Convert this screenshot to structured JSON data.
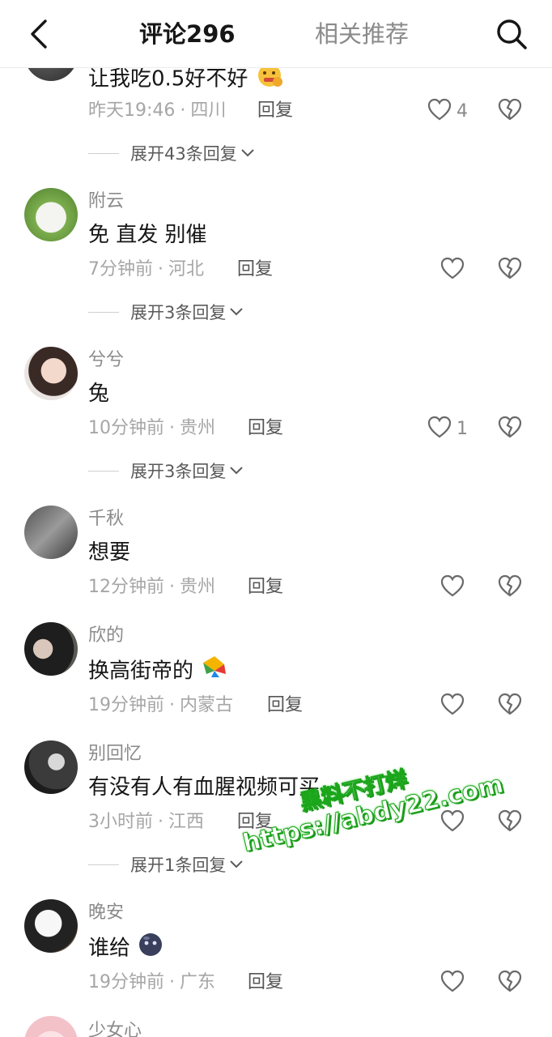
{
  "header": {
    "tab_comments_label": "评论",
    "tab_comments_count": "296",
    "tab_related_label": "相关推荐"
  },
  "comments": [
    {
      "username": "",
      "content": "让我吃0.5好不好",
      "emoji": "money-mouth-emoji",
      "time": "昨天19:46",
      "location": "四川",
      "reply": "回复",
      "likes": "4",
      "expand": "展开43条回复"
    },
    {
      "username": "附云",
      "content": "免 直发 别催",
      "time": "7分钟前",
      "location": "河北",
      "reply": "回复",
      "likes": "",
      "expand": "展开3条回复"
    },
    {
      "username": "兮兮",
      "content": "兔",
      "time": "10分钟前",
      "location": "贵州",
      "reply": "回复",
      "likes": "1",
      "expand": "展开3条回复"
    },
    {
      "username": "千秋",
      "content": "想要",
      "time": "12分钟前",
      "location": "贵州",
      "reply": "回复",
      "likes": ""
    },
    {
      "username": "欣的",
      "content": "换高街帝的",
      "emoji": "kite-emoji",
      "time": "19分钟前",
      "location": "内蒙古",
      "reply": "回复",
      "likes": ""
    },
    {
      "username": "别回忆",
      "content": "有没有人有血腥视频可买",
      "time": "3小时前",
      "location": "江西",
      "reply": "回复",
      "likes": "",
      "expand": "展开1条回复"
    },
    {
      "username": "晚安",
      "content": "谁给",
      "emoji": "dark-ball-emoji",
      "time": "19分钟前",
      "location": "广东",
      "reply": "回复",
      "likes": ""
    },
    {
      "username": "少女心",
      "content": "",
      "time": "",
      "location": "",
      "reply": "",
      "likes": ""
    }
  ],
  "watermark": {
    "line1": "黑料不打烊",
    "line2": "https://abdy22.com"
  },
  "icons": {
    "back": "chevron-left-icon",
    "search": "search-icon",
    "like": "heart-outline-icon",
    "dislike": "broken-heart-icon",
    "expand": "chevron-down-icon"
  },
  "colors": {
    "text_primary": "#161616",
    "text_secondary": "#8a8a8a",
    "watermark_green": "#1aa51a"
  }
}
